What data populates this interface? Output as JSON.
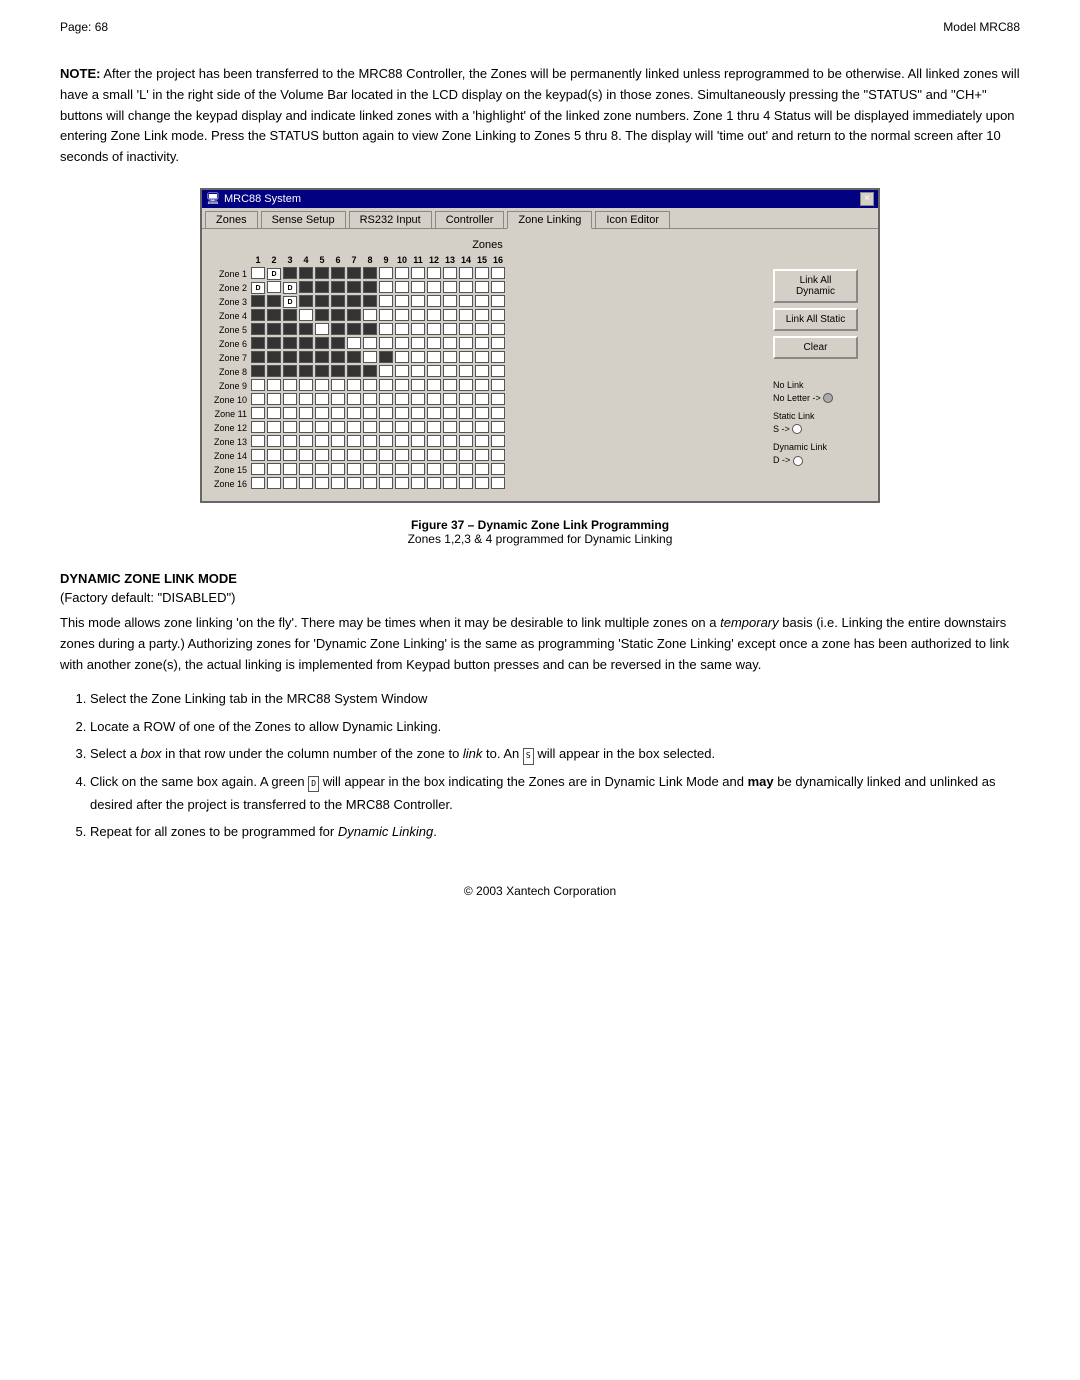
{
  "header": {
    "page_label": "Page:",
    "page_number": "68",
    "model_label": "Model MRC88"
  },
  "note": {
    "text": "NOTE: After the project has been transferred to the MRC88 Controller, the Zones will be permanently linked unless reprogrammed to be otherwise. All linked zones will have a small 'L' in the right side of the Volume Bar located in the LCD display on the keypad(s) in those zones. Simultaneously pressing the \"STATUS\" and \"CH+\" buttons will change the keypad display and indicate linked zones with a 'highlight' of the linked zone numbers. Zone 1 thru 4 Status will be displayed immediately upon entering Zone Link mode. Press the STATUS button again to view Zone Linking to Zones 5 thru 8. The display will 'time out' and return to the normal screen after 10 seconds of inactivity."
  },
  "window": {
    "title": "MRC88 System",
    "close_btn": "×",
    "tabs": [
      "Zones",
      "Sense Setup",
      "RS232 Input",
      "Controller",
      "Zone Linking",
      "Icon Editor"
    ],
    "active_tab": "Zone Linking"
  },
  "grid": {
    "zones_label": "Zones",
    "col_headers": [
      "1",
      "2",
      "3",
      "4",
      "5",
      "6",
      "7",
      "8",
      "9",
      "10",
      "11",
      "12",
      "13",
      "14",
      "15",
      "16"
    ],
    "row_labels": [
      "Zone 1",
      "Zone 2",
      "Zone 3",
      "Zone 4",
      "Zone 5",
      "Zone 6",
      "Zone 7",
      "Zone 8",
      "Zone 9",
      "Zone 10",
      "Zone 11",
      "Zone 12",
      "Zone 13",
      "Zone 14",
      "Zone 15",
      "Zone 16"
    ]
  },
  "buttons": {
    "link_all_dynamic": "Link All Dynamic",
    "link_all_static": "Link All Static",
    "clear": "Clear"
  },
  "legend": {
    "no_link_label": "No Link",
    "no_letter_label": "No Letter ->",
    "static_link_label": "Static Link",
    "static_abbr": "S ->",
    "dynamic_link_label": "Dynamic Link",
    "dynamic_abbr": "D ->"
  },
  "figure": {
    "caption_line1": "Figure 37 – Dynamic Zone Link Programming",
    "caption_line2": "Zones 1,2,3 & 4 programmed for Dynamic Linking"
  },
  "section": {
    "title": "DYNAMIC ZONE LINK MODE",
    "subtitle": "(Factory default: \"DISABLED\")",
    "body": "This mode allows zone linking 'on the fly'. There may be times when it may be desirable to link multiple zones on a temporary basis (i.e. Linking the entire downstairs zones during a party.) Authorizing zones for 'Dynamic Zone Linking' is the same as programming 'Static Zone Linking' except once a zone has been authorized to link with another zone(s), the actual linking is implemented from Keypad button presses and can be reversed in the same way.",
    "steps": [
      "Select the Zone Linking tab in the MRC88 System Window",
      "Locate a ROW of one of the Zones to allow Dynamic Linking.",
      "Select a box in that row under the column number of the zone to link to. An  will appear in the box selected.",
      "Click on the same box again. A green  will appear in the box indicating the Zones are in Dynamic Link Mode and may be dynamically linked and unlinked as desired after the project is transferred to the MRC88 Controller.",
      "Repeat for all zones to be programmed for Dynamic Linking."
    ]
  },
  "footer": {
    "text": "© 2003 Xantech Corporation"
  }
}
